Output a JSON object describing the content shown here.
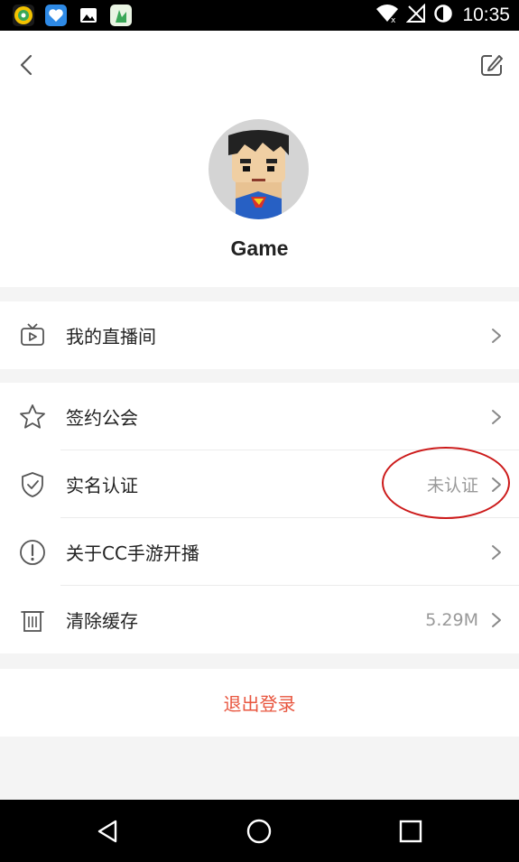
{
  "status_bar": {
    "time": "10:35",
    "app_icons": [
      "maps-app-icon",
      "heart-app-icon",
      "gallery-app-icon",
      "game-app-icon"
    ]
  },
  "header": {
    "back_icon": "chevron-left-icon",
    "edit_icon": "edit-icon"
  },
  "profile": {
    "username": "Game",
    "avatar_icon": "superman-avatar"
  },
  "menu_group_1": [
    {
      "label": "我的直播间",
      "icon": "tv-play-icon"
    }
  ],
  "menu_group_2": [
    {
      "label": "签约公会",
      "icon": "star-icon",
      "value": ""
    },
    {
      "label": "实名认证",
      "icon": "shield-check-icon",
      "value": "未认证"
    },
    {
      "label": "关于CC手游开播",
      "icon": "info-circle-icon",
      "value": ""
    },
    {
      "label": "清除缓存",
      "icon": "trash-icon",
      "value": "5.29M"
    }
  ],
  "logout": {
    "label": "退出登录"
  },
  "colors": {
    "accent_red": "#e8553e",
    "annotation_red": "#cc1a1a",
    "secondary_text": "#999999"
  }
}
